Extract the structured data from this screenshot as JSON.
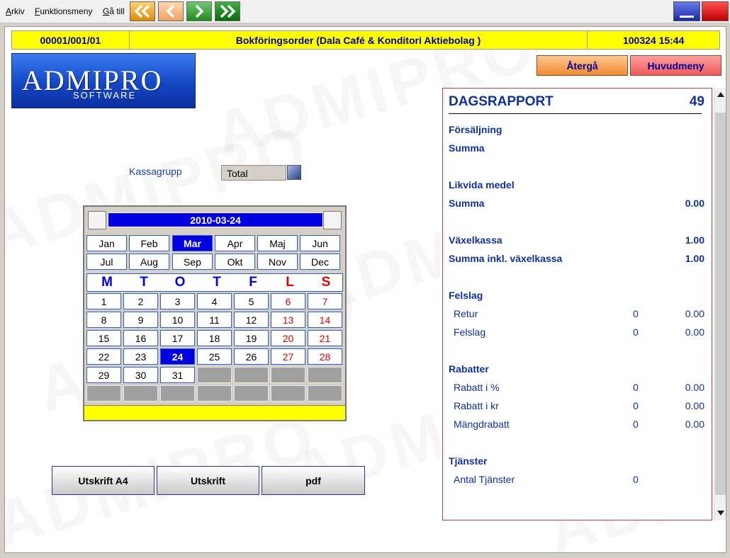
{
  "menu": {
    "items": [
      "Arkiv",
      "Funktionsmeny",
      "Gå till"
    ]
  },
  "header": {
    "code": "00001/001/01",
    "title": "Bokföringsorder (Dala Café & Konditori Aktiebolag )",
    "datetime": "100324 15:44"
  },
  "logo": {
    "main": "ADMIPRO",
    "sub": "SOFTWARE"
  },
  "buttons": {
    "back": "Återgå",
    "main_menu": "Huvudmeny",
    "print_a4": "Utskrift A4",
    "print": "Utskrift",
    "pdf": "pdf"
  },
  "kassagrupp": {
    "label": "Kassagrupp",
    "value": "Total"
  },
  "calendar": {
    "date": "2010-03-24",
    "months": [
      "Jan",
      "Feb",
      "Mar",
      "Apr",
      "Maj",
      "Jun",
      "Jul",
      "Aug",
      "Sep",
      "Okt",
      "Nov",
      "Dec"
    ],
    "selected_month": "Mar",
    "weekdays": [
      "M",
      "T",
      "O",
      "T",
      "F",
      "L",
      "S"
    ],
    "weeks": [
      [
        "1",
        "2",
        "3",
        "4",
        "5",
        "6",
        "7"
      ],
      [
        "8",
        "9",
        "10",
        "11",
        "12",
        "13",
        "14"
      ],
      [
        "15",
        "16",
        "17",
        "18",
        "19",
        "20",
        "21"
      ],
      [
        "22",
        "23",
        "24",
        "25",
        "26",
        "27",
        "28"
      ],
      [
        "29",
        "30",
        "31",
        "",
        "",
        "",
        ""
      ],
      [
        "",
        "",
        "",
        "",
        "",
        "",
        ""
      ]
    ],
    "selected_day": "24"
  },
  "report": {
    "title": "DAGSRAPPORT",
    "number": "49",
    "forsaljning": {
      "heading": "Försäljning",
      "summa_label": "Summa"
    },
    "likvida": {
      "heading": "Likvida medel",
      "summa_label": "Summa",
      "summa_value": "0.00"
    },
    "vaxelkassa": {
      "label": "Växelkassa",
      "value": "1.00",
      "incl_label": "Summa inkl. växelkassa",
      "incl_value": "1.00"
    },
    "felslag": {
      "heading": "Felslag",
      "rows": [
        {
          "label": "Retur",
          "count": "0",
          "amount": "0.00"
        },
        {
          "label": "Felslag",
          "count": "0",
          "amount": "0.00"
        }
      ]
    },
    "rabatter": {
      "heading": "Rabatter",
      "rows": [
        {
          "label": "Rabatt i %",
          "count": "0",
          "amount": "0.00"
        },
        {
          "label": "Rabatt i kr",
          "count": "0",
          "amount": "0.00"
        },
        {
          "label": "Mängdrabatt",
          "count": "0",
          "amount": "0.00"
        }
      ]
    },
    "tjanster": {
      "heading": "Tjänster",
      "rows": [
        {
          "label": "Antal Tjänster",
          "count": "0"
        }
      ]
    }
  },
  "colors": {
    "header_bg": "#ffff00",
    "accent_blue": "#0000e0",
    "weekend_red": "#e00000",
    "back_button": "#f5a05a",
    "main_menu_button": "#f07070"
  }
}
